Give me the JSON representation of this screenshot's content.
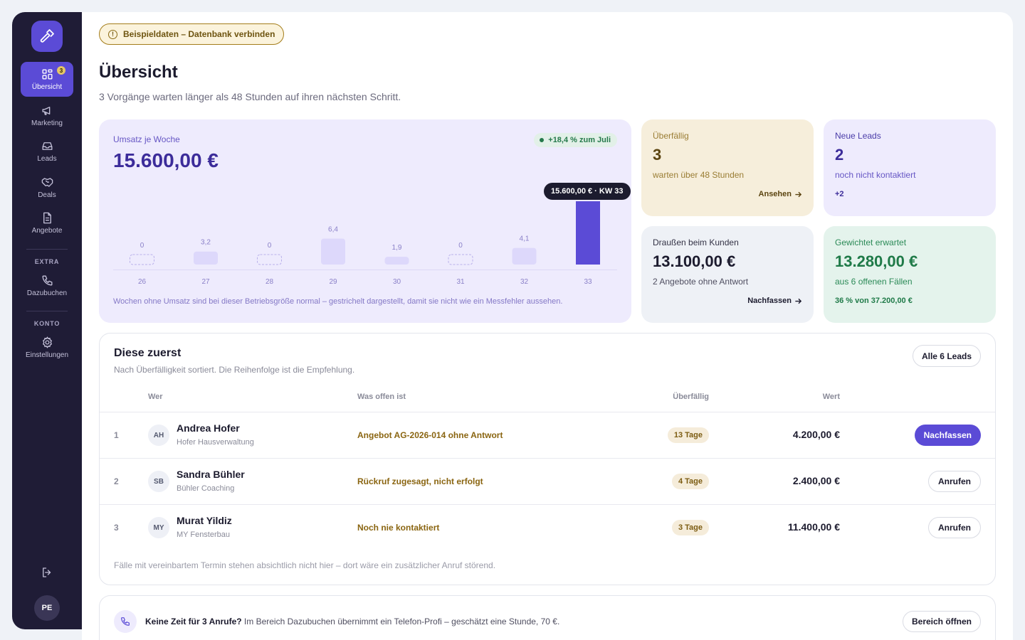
{
  "sidebar": {
    "logo_icon": "hammer-icon",
    "items": [
      {
        "label": "Übersicht",
        "icon": "dashboard-icon",
        "badge": "3",
        "active": true
      },
      {
        "label": "Marketing",
        "icon": "megaphone-icon"
      },
      {
        "label": "Leads",
        "icon": "inbox-icon"
      },
      {
        "label": "Deals",
        "icon": "handshake-icon"
      },
      {
        "label": "Angebote",
        "icon": "document-icon"
      }
    ],
    "extra_label": "EXTRA",
    "extra_items": [
      {
        "label": "Dazubuchen",
        "icon": "phone-icon"
      }
    ],
    "account_label": "KONTO",
    "account_items": [
      {
        "label": "Einstellungen",
        "icon": "gear-icon"
      }
    ],
    "logout_icon": "logout-icon",
    "user_initials": "PE"
  },
  "demo_banner": "Beispieldaten – Datenbank verbinden",
  "header": {
    "title": "Übersicht",
    "subtitle": "3 Vorgänge warten länger als 48 Stunden auf ihren nächsten Schritt."
  },
  "revenue": {
    "label": "Umsatz je Woche",
    "value": "15.600,00 €",
    "trend": "+18,4 % zum Juli",
    "tooltip": "15.600,00 € · KW 33",
    "note": "Wochen ohne Umsatz sind bei dieser Betriebsgröße normal – gestrichelt dargestellt, damit sie nicht wie ein Messfehler aussehen."
  },
  "chart_data": {
    "type": "bar",
    "categories": [
      "26",
      "27",
      "28",
      "29",
      "30",
      "31",
      "32",
      "33"
    ],
    "values": [
      0,
      3.2,
      0,
      6.4,
      1.9,
      0,
      4.1,
      15.6
    ],
    "value_labels": [
      "0",
      "3,2",
      "0",
      "6,4",
      "1,9",
      "0",
      "4,1",
      ""
    ],
    "highlight_index": 7,
    "ylim": [
      0,
      15.6
    ],
    "colors": {
      "normal": "#ddd8fb",
      "highlight": "#5b4bd6",
      "empty_dash": "#b9b0ea"
    }
  },
  "cards": {
    "overdue": {
      "label": "Überfällig",
      "value": "3",
      "sub": "warten über 48 Stunden",
      "link": "Ansehen"
    },
    "leads": {
      "label": "Neue Leads",
      "value": "2",
      "sub": "noch nicht kontaktiert",
      "foot": "+2"
    },
    "out": {
      "label": "Draußen beim Kunden",
      "value": "13.100,00 €",
      "sub": "2 Angebote ohne Antwort",
      "link": "Nachfassen"
    },
    "weighted": {
      "label": "Gewichtet erwartet",
      "value": "13.280,00 €",
      "sub": "aus 6 offenen Fällen",
      "foot": "36 % von 37.200,00 €"
    }
  },
  "priority": {
    "title": "Diese zuerst",
    "subtitle": "Nach Überfälligkeit sortiert. Die Reihenfolge ist die Empfehlung.",
    "all_button": "Alle 6 Leads",
    "columns": {
      "who": "Wer",
      "open": "Was offen ist",
      "overdue": "Überfällig",
      "value": "Wert"
    },
    "rows": [
      {
        "num": "1",
        "initials": "AH",
        "name": "Andrea Hofer",
        "company": "Hofer Hausverwaltung",
        "open": "Angebot AG-2026-014 ohne Antwort",
        "days": "13 Tage",
        "value": "4.200,00 €",
        "action": "Nachfassen"
      },
      {
        "num": "2",
        "initials": "SB",
        "name": "Sandra Bühler",
        "company": "Bühler Coaching",
        "open": "Rückruf zugesagt, nicht erfolgt",
        "days": "4 Tage",
        "value": "2.400,00 €",
        "action": "Anrufen"
      },
      {
        "num": "3",
        "initials": "MY",
        "name": "Murat Yildiz",
        "company": "MY Fensterbau",
        "open": "Noch nie kontaktiert",
        "days": "3 Tage",
        "value": "11.400,00 €",
        "action": "Anrufen"
      }
    ],
    "footnote": "Fälle mit vereinbartem Termin stehen absichtlich nicht hier – dort wäre ein zusätzlicher Anruf störend."
  },
  "upsell": {
    "bold": "Keine Zeit für 3 Anrufe?",
    "text": " Im Bereich Dazubuchen übernimmt ein Telefon-Profi – geschätzt eine Stunde, 70 €.",
    "button": "Bereich öffnen"
  }
}
